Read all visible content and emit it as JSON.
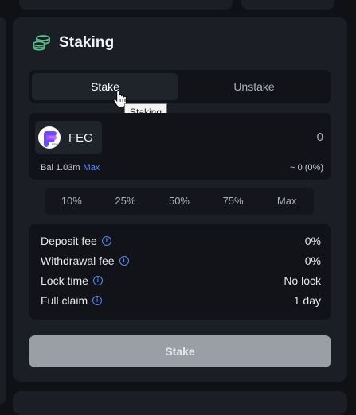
{
  "header": {
    "title": "Staking",
    "icon": "coins-stack-icon",
    "icon_color": "#5bbf8a"
  },
  "tabs": [
    {
      "label": "Stake",
      "active": true
    },
    {
      "label": "Unstake",
      "active": false
    }
  ],
  "tooltip": {
    "text": "Staking"
  },
  "token": {
    "symbol": "FEG",
    "logo_text": "FEG",
    "amount": "0"
  },
  "balance": {
    "label": "Bal 1.03m",
    "max_label": "Max",
    "usd": "~ 0 (0%)"
  },
  "percent_buttons": [
    "10%",
    "25%",
    "50%",
    "75%",
    "Max"
  ],
  "info": [
    {
      "label": "Deposit fee",
      "value": "0%"
    },
    {
      "label": "Withdrawal fee",
      "value": "0%"
    },
    {
      "label": "Lock time",
      "value": "No lock"
    },
    {
      "label": "Full claim",
      "value": "1 day"
    }
  ],
  "info_icon": "i",
  "action": {
    "label": "Stake",
    "enabled": false
  },
  "colors": {
    "accent": "#4f8dff",
    "card": "#1b1e24",
    "inset": "#111318",
    "button_disabled": "#9a9ea6"
  }
}
